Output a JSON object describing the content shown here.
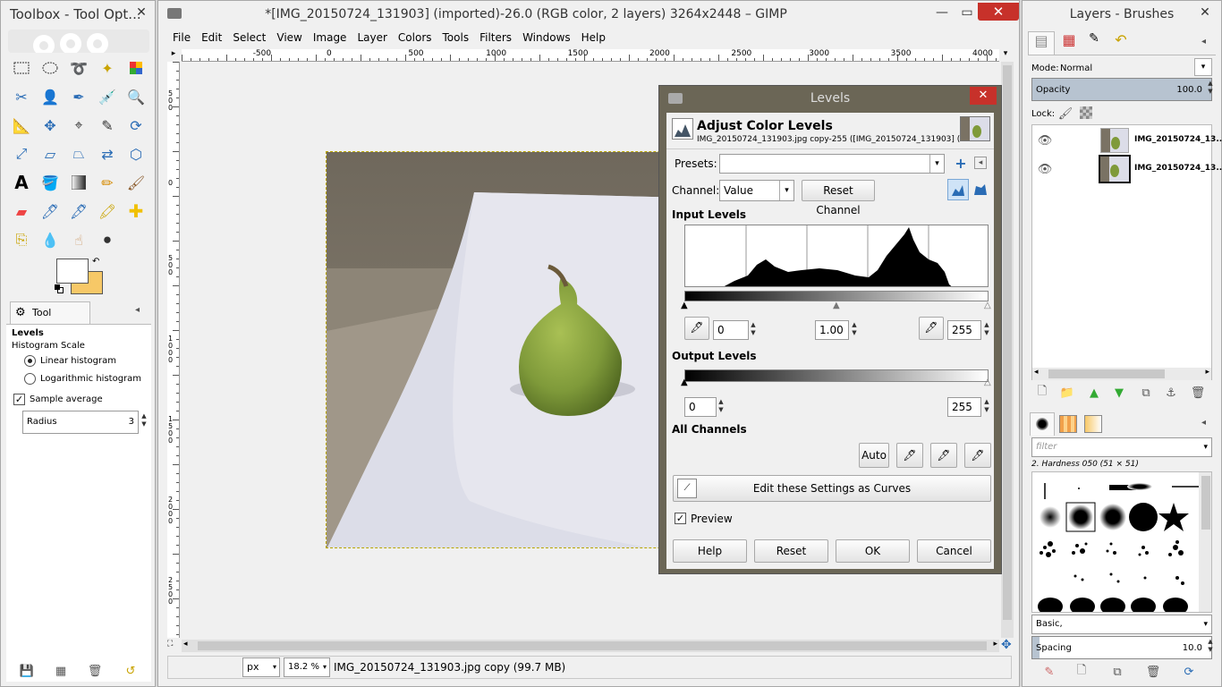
{
  "toolbox": {
    "title": "Toolbox - Tool Opt...",
    "tool_options_tab": "Tool Options",
    "tool_name": "Levels",
    "histogram_scale_label": "Histogram Scale",
    "linear_label": "Linear histogram",
    "log_label": "Logarithmic histogram",
    "sample_average_label": "Sample average",
    "radius_label": "Radius",
    "radius_value": "3"
  },
  "main": {
    "title": "*[IMG_20150724_131903] (imported)-26.0 (RGB color, 2 layers) 3264x2448 – GIMP",
    "menu": [
      "File",
      "Edit",
      "Select",
      "View",
      "Image",
      "Layer",
      "Colors",
      "Tools",
      "Filters",
      "Windows",
      "Help"
    ],
    "ruler_h": [
      {
        "label": "-500",
        "pos": 0.085
      },
      {
        "label": "0",
        "pos": 0.175
      },
      {
        "label": "500",
        "pos": 0.275
      },
      {
        "label": "1000",
        "pos": 0.37
      },
      {
        "label": "1500",
        "pos": 0.47
      },
      {
        "label": "2000",
        "pos": 0.57
      },
      {
        "label": "2500",
        "pos": 0.67
      },
      {
        "label": "3000",
        "pos": 0.765
      },
      {
        "label": "3500",
        "pos": 0.865
      },
      {
        "label": "4000",
        "pos": 0.965
      }
    ],
    "ruler_v": [
      {
        "label": "5\n0\n0",
        "pos": 0.05
      },
      {
        "label": "0",
        "pos": 0.205
      },
      {
        "label": "5\n0\n0",
        "pos": 0.335
      },
      {
        "label": "1\n0\n0\n0",
        "pos": 0.475
      },
      {
        "label": "1\n5\n0\n0",
        "pos": 0.615
      },
      {
        "label": "2\n0\n0\n0",
        "pos": 0.755
      },
      {
        "label": "2\n5\n0\n0",
        "pos": 0.895
      }
    ],
    "unit": "px",
    "zoom": "18.2 %",
    "status": "IMG_20150724_131903.jpg copy (99.7 MB)"
  },
  "levels": {
    "title": "Levels",
    "heading": "Adjust Color Levels",
    "subtitle": "IMG_20150724_131903.jpg copy-255 ([IMG_20150724_131903] (i...",
    "presets_label": "Presets:",
    "presets_value": "",
    "channel_label": "Channel:",
    "channel_value": "Value",
    "reset_channel": "Reset Channel",
    "input_levels": "Input Levels",
    "input_low": "0",
    "input_gamma": "1.00",
    "input_high": "255",
    "output_levels": "Output Levels",
    "output_low": "0",
    "output_high": "255",
    "all_channels": "All Channels",
    "auto": "Auto",
    "edit_curves": "Edit these Settings as Curves",
    "preview": "Preview",
    "help": "Help",
    "reset": "Reset",
    "ok": "OK",
    "cancel": "Cancel"
  },
  "layers": {
    "title": "Layers - Brushes",
    "mode_label": "Mode:",
    "mode_value": "Normal",
    "opacity_label": "Opacity",
    "opacity_value": "100.0",
    "lock_label": "Lock:",
    "items": [
      {
        "name": "IMG_20150724_13..."
      },
      {
        "name": "IMG_20150724_13..."
      }
    ]
  },
  "brushes": {
    "filter_placeholder": "filter",
    "current": "2. Hardness 050 (51 × 51)",
    "tag": "Basic,",
    "spacing_label": "Spacing",
    "spacing_value": "10.0"
  },
  "colors": {
    "accent": "#3a7dc9",
    "fg": "#ffffff",
    "bg": "#f7c867",
    "pear": "#7f9a3a",
    "dialog_frame": "#6b6656"
  }
}
